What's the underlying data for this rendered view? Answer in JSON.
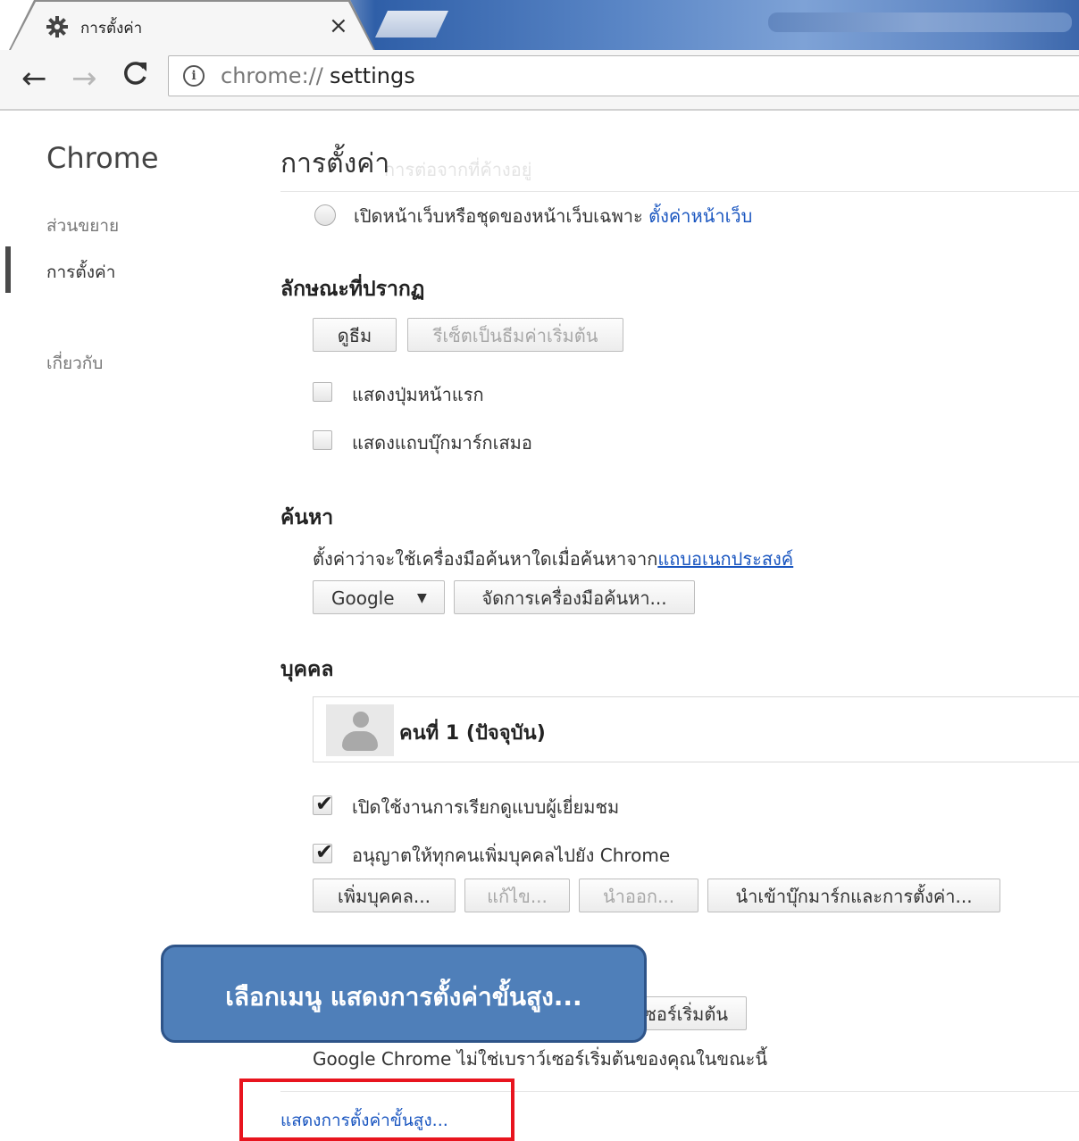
{
  "tab": {
    "title": "การตั้งค่า",
    "close": "×"
  },
  "toolbar": {
    "back": "←",
    "forward": "→",
    "reload": "C",
    "info": "i"
  },
  "address": {
    "scheme": "chrome://",
    "host": "settings"
  },
  "sidebar": {
    "title": "Chrome",
    "items": [
      {
        "label": "ส่วนขยาย"
      },
      {
        "label": "การตั้งค่า"
      },
      {
        "label": "เกี่ยวกับ"
      }
    ]
  },
  "main": {
    "title": "การตั้งค่า",
    "ghost": "การต่อจากที่ค้างอยู่",
    "startup": {
      "radio_label": "เปิดหน้าเว็บหรือชุดของหน้าเว็บเฉพาะ",
      "link": "ตั้งค่าหน้าเว็บ"
    },
    "appearance": {
      "heading": "ลักษณะที่ปรากฏ",
      "themes_button": "ดูธีม",
      "reset_button": "รีเซ็ตเป็นธีมค่าเริ่มต้น",
      "show_home": "แสดงปุ่มหน้าแรก",
      "show_bookmarks": "แสดงแถบบุ๊กมาร์กเสมอ"
    },
    "search": {
      "heading": "ค้นหา",
      "description": "ตั้งค่าว่าจะใช้เครื่องมือค้นหาใดเมื่อค้นหาจาก",
      "link": "แถบอเนกประสงค์",
      "engine": "Google",
      "manage_button": "จัดการเครื่องมือค้นหา..."
    },
    "people": {
      "heading": "บุคคล",
      "profile_name": "คนที่ 1 (ปัจจุบัน)",
      "guest_browsing": "เปิดใช้งานการเรียกดูแบบผู้เยี่ยมชม",
      "anyone_add": "อนุญาตให้ทุกคนเพิ่มบุคคลไปยัง Chrome",
      "add_button": "เพิ่มบุคคล...",
      "edit_button": "แก้ไข...",
      "remove_button": "นำออก...",
      "import_button": "นำเข้าบุ๊กมาร์กและการตั้งค่า..."
    },
    "default_browser": {
      "button_partial": "ซอร์เริ่มต้น",
      "status": "Google Chrome ไม่ใช่เบราว์เซอร์เริ่มต้นของคุณในขณะนี้"
    },
    "advanced_link": "แสดงการตั้งค่าขั้นสูง..."
  },
  "callout": {
    "text": "เลือกเมนู แสดงการตั้งค่าขั้นสูง..."
  },
  "colors": {
    "link": "#1a56c0",
    "callout": "#4f7fb9",
    "highlight": "#e8141e"
  }
}
